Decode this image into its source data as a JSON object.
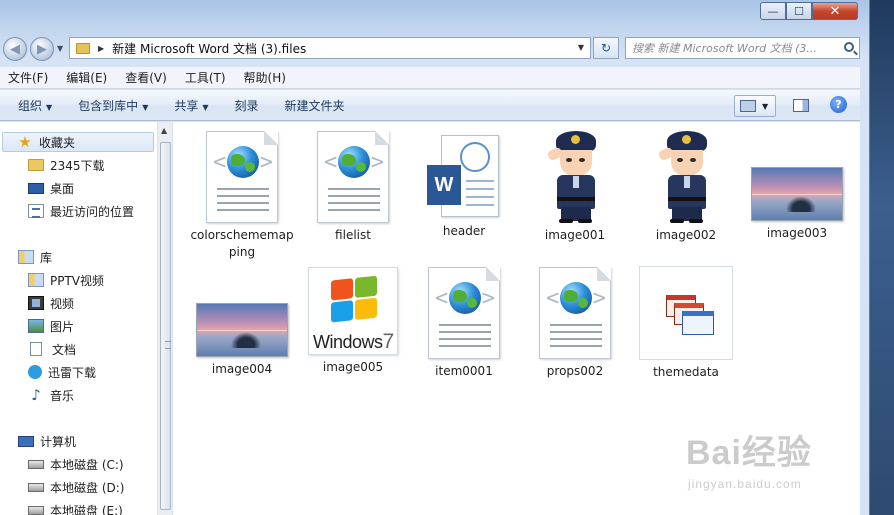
{
  "window": {
    "caption_buttons": {
      "minimize": "—",
      "maximize": "☐",
      "close": "✕"
    }
  },
  "address_bar": {
    "path": "新建 Microsoft Word 文档 (3).files",
    "search_placeholder": "搜索 新建 Microsoft Word 文档 (3...",
    "refresh_symbol": "↻"
  },
  "menubar": [
    "文件(F)",
    "编辑(E)",
    "查看(V)",
    "工具(T)",
    "帮助(H)"
  ],
  "commandbar": {
    "organize": "组织",
    "include_in_library": "包含到库中",
    "share": "共享",
    "burn": "刻录",
    "new_folder": "新建文件夹",
    "help": "?"
  },
  "nav": {
    "favorites": "收藏夹",
    "fav_items": [
      "2345下载",
      "桌面",
      "最近访问的位置"
    ],
    "libraries": "库",
    "lib_items": [
      "PPTV视频",
      "视频",
      "图片",
      "文档",
      "迅雷下载",
      "音乐"
    ],
    "computer": "计算机",
    "drives": [
      "本地磁盘 (C:)",
      "本地磁盘 (D:)",
      "本地磁盘 (E:)"
    ]
  },
  "files": [
    {
      "name": "colorschememapping",
      "icon": "html-doc-icon"
    },
    {
      "name": "filelist",
      "icon": "html-doc-icon"
    },
    {
      "name": "header",
      "icon": "word-doc-icon"
    },
    {
      "name": "image001",
      "icon": "police-thumbnail"
    },
    {
      "name": "image002",
      "icon": "police-thumbnail"
    },
    {
      "name": "image003",
      "icon": "sea-thumbnail"
    },
    {
      "name": "image004",
      "icon": "sea-thumbnail"
    },
    {
      "name": "image005",
      "icon": "windows7-thumbnail"
    },
    {
      "name": "item0001",
      "icon": "html-doc-icon"
    },
    {
      "name": "props002",
      "icon": "html-doc-icon"
    },
    {
      "name": "themedata",
      "icon": "theme-icon"
    }
  ],
  "watermark": {
    "brand": "Bai经验",
    "url": "jingyan.baidu.com"
  },
  "colors": {
    "accent": "#1e395b",
    "selection": "#d9e7f7",
    "close": "#c7472e"
  }
}
